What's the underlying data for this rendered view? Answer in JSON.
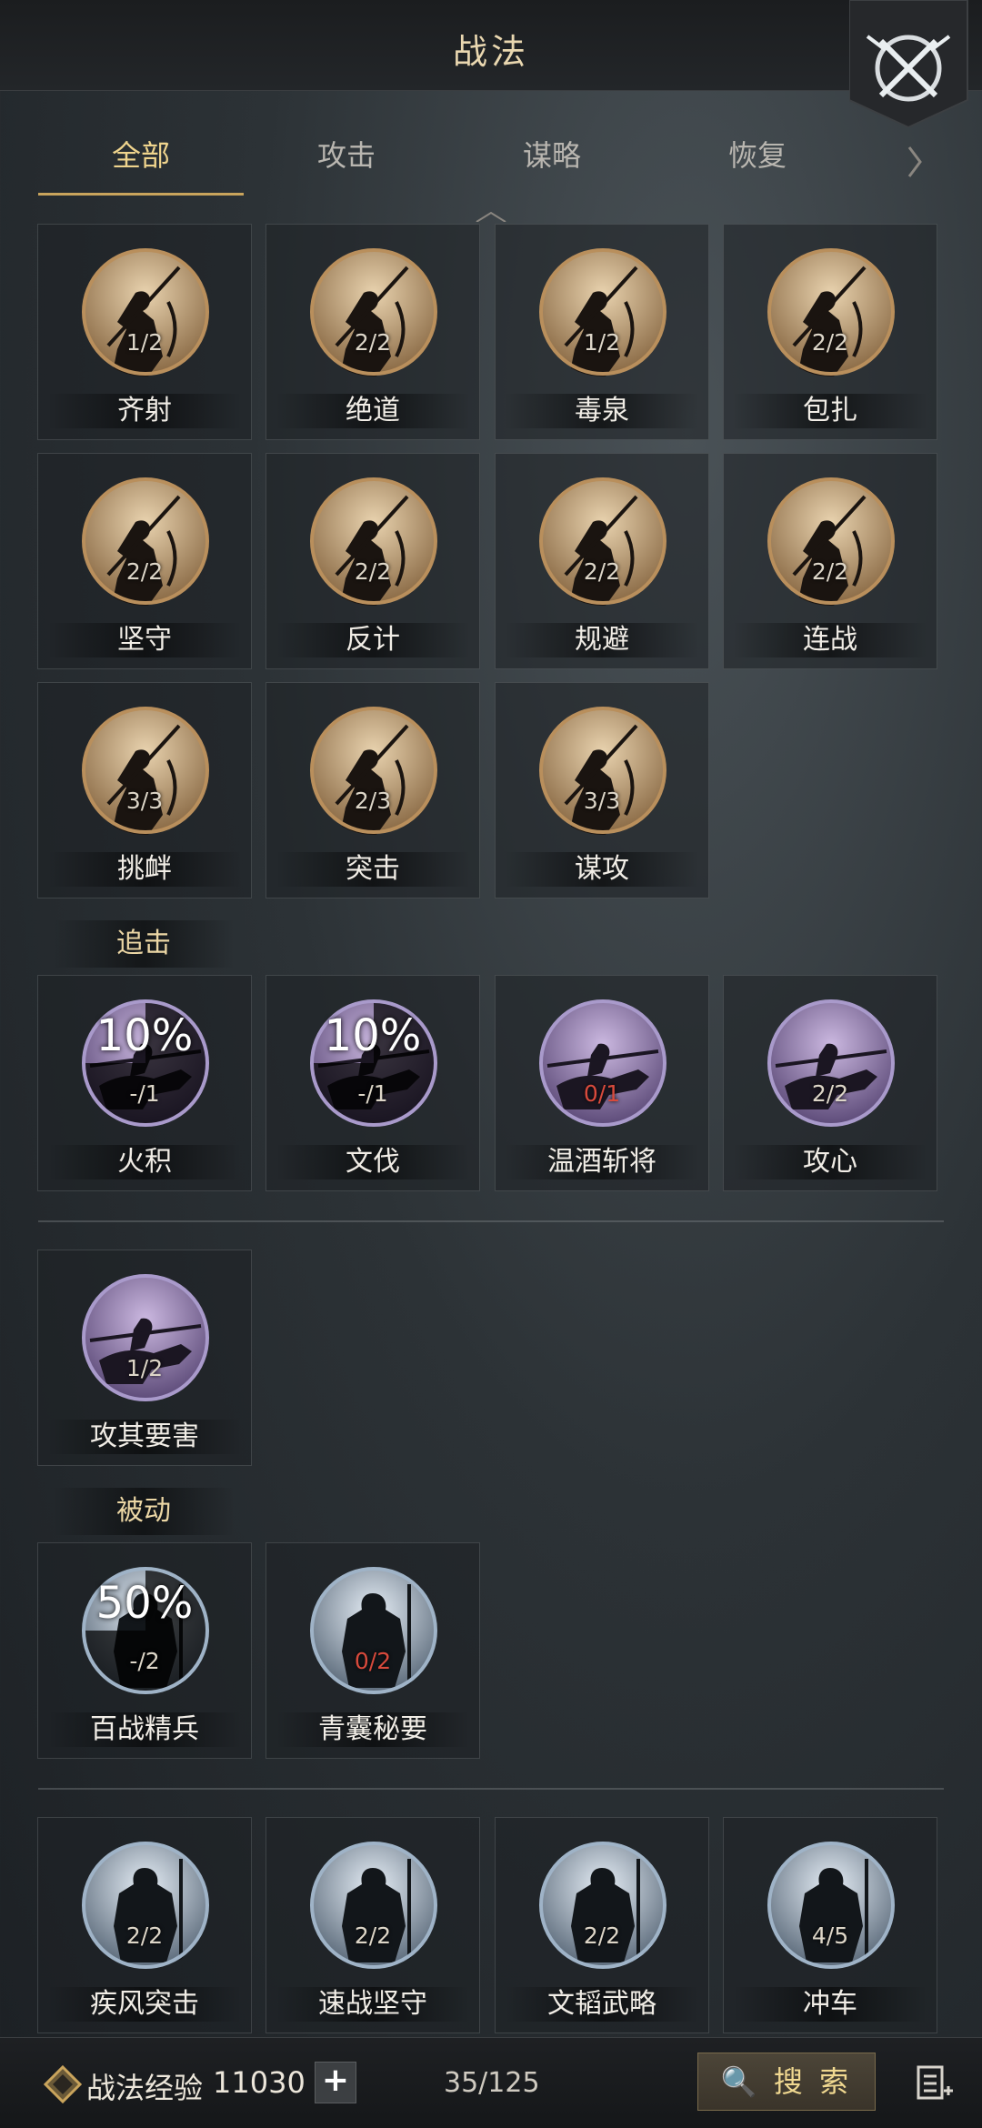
{
  "header": {
    "title": "战法"
  },
  "tabs": [
    "全部",
    "攻击",
    "谋略",
    "恢复"
  ],
  "grid1": [
    {
      "name": "齐射",
      "level": "1/2"
    },
    {
      "name": "绝道",
      "level": "2/2"
    },
    {
      "name": "毒泉",
      "level": "1/2"
    },
    {
      "name": "包扎",
      "level": "2/2"
    },
    {
      "name": "坚守",
      "level": "2/2"
    },
    {
      "name": "反计",
      "level": "2/2"
    },
    {
      "name": "规避",
      "level": "2/2"
    },
    {
      "name": "连战",
      "level": "2/2"
    },
    {
      "name": "挑衅",
      "level": "3/3"
    },
    {
      "name": "突击",
      "level": "2/3"
    },
    {
      "name": "谋攻",
      "level": "3/3"
    }
  ],
  "section_pursuit": "追击",
  "grid2": [
    {
      "name": "火积",
      "level": "-/1",
      "percent": "10%"
    },
    {
      "name": "文伐",
      "level": "-/1",
      "percent": "10%"
    },
    {
      "name": "温酒斩将",
      "level": "0/1"
    },
    {
      "name": "攻心",
      "level": "2/2"
    }
  ],
  "grid3": [
    {
      "name": "攻其要害",
      "level": "1/2"
    }
  ],
  "section_passive": "被动",
  "grid4": [
    {
      "name": "百战精兵",
      "level": "-/2",
      "percent": "50%"
    },
    {
      "name": "青囊秘要",
      "level": "0/2"
    }
  ],
  "grid5": [
    {
      "name": "疾风突击",
      "level": "2/2"
    },
    {
      "name": "速战坚守",
      "level": "2/2"
    },
    {
      "name": "文韬武略",
      "level": "2/2"
    },
    {
      "name": "冲车",
      "level": "4/5"
    }
  ],
  "footer": {
    "exp_label": "战法经验",
    "exp_value": "11030",
    "plus": "+",
    "count": "35/125",
    "search": "🔍 搜 索"
  },
  "colors": {
    "accent": "#efd48d",
    "red_level": "#d84a3c"
  }
}
